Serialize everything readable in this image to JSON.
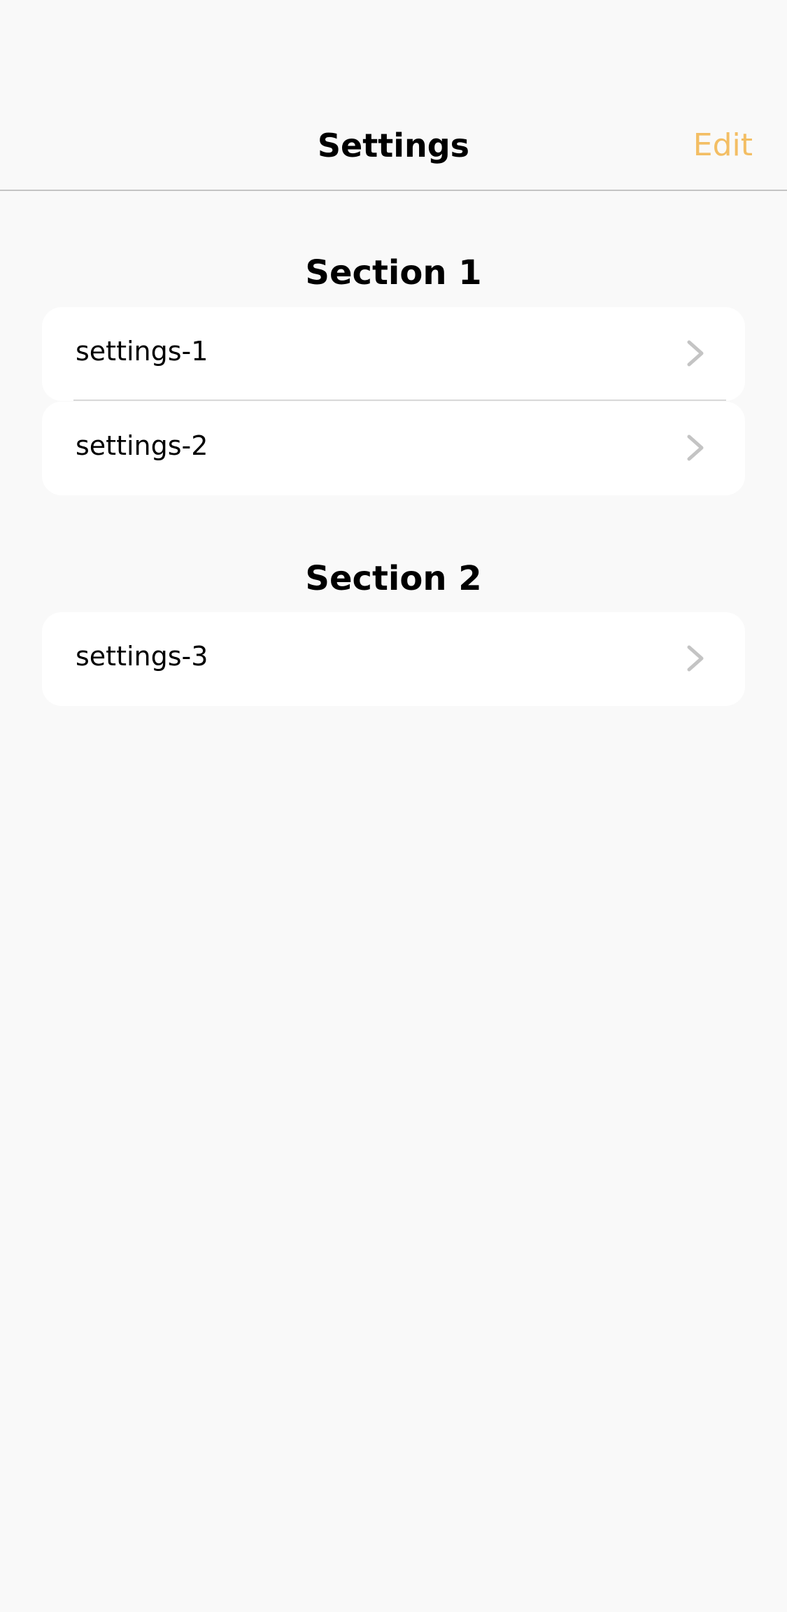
{
  "header": {
    "title": "Settings",
    "edit_label": "Edit"
  },
  "sections": [
    {
      "title": "Section 1",
      "items": [
        {
          "label": "settings-1",
          "icon": "chevron-right-icon"
        },
        {
          "label": "settings-2",
          "icon": "chevron-right-icon"
        }
      ]
    },
    {
      "title": "Section 2",
      "items": [
        {
          "label": "settings-3",
          "icon": "chevron-right-icon"
        }
      ]
    }
  ],
  "colors": {
    "background": "#f9f9f9",
    "accent": "#f3be64",
    "chevron": "#c4c4c4",
    "card": "#ffffff"
  }
}
